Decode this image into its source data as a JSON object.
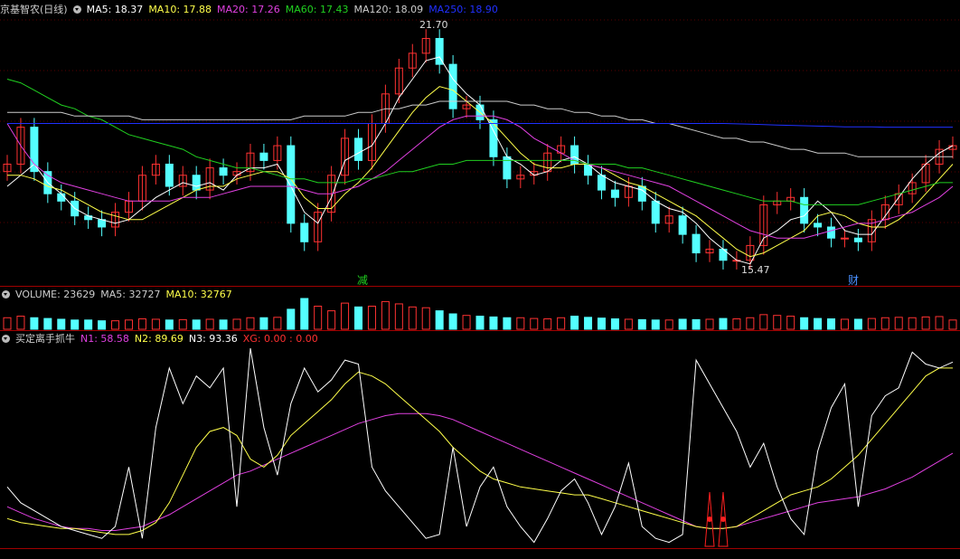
{
  "main": {
    "stock_name": "京基智农(日线)",
    "ma": [
      {
        "label": "MA5: 18.37",
        "color": "#ffffff"
      },
      {
        "label": "MA10: 17.88",
        "color": "#ffff4a"
      },
      {
        "label": "MA20: 17.26",
        "color": "#e040e0"
      },
      {
        "label": "MA60: 17.43",
        "color": "#20d020"
      },
      {
        "label": "MA120: 18.09",
        "color": "#cccccc"
      },
      {
        "label": "MA250: 18.90",
        "color": "#2030ff"
      }
    ],
    "high_label": "21.70",
    "low_label": "15.47",
    "marker_jian": "减",
    "marker_cai": "财"
  },
  "volume": {
    "label": "VOLUME: 23629",
    "ma5": "MA5: 32727",
    "ma10": "MA10: 32767",
    "colors": {
      "label": "#cccccc",
      "ma5": "#cccccc",
      "ma10": "#ffff4a"
    }
  },
  "indicator": {
    "name": "买定离手抓牛",
    "items": [
      {
        "label": "N1: 58.58",
        "color": "#e040e0"
      },
      {
        "label": "N2: 89.69",
        "color": "#ffff4a"
      },
      {
        "label": "N3: 93.36",
        "color": "#ffffff"
      },
      {
        "label": "XG: 0.00 : 0.00",
        "color": "#ff3030"
      }
    ]
  },
  "chart_data": [
    {
      "type": "line",
      "title": "京基智农(日线)",
      "series": [
        {
          "name": "MA5",
          "color": "#ffffff",
          "values": [
            17.3,
            17.6,
            17.9,
            17.4,
            17.1,
            16.7,
            16.5,
            16.4,
            16.3,
            16.4,
            16.7,
            17.0,
            17.2,
            17.4,
            17.3,
            17.4,
            17.2,
            17.6,
            17.8,
            17.8,
            17.9,
            17.3,
            16.6,
            16.3,
            17.0,
            18.0,
            18.2,
            18.4,
            19.0,
            19.7,
            20.2,
            20.7,
            20.8,
            20.2,
            19.8,
            19.5,
            18.8,
            18.1,
            17.9,
            17.6,
            17.7,
            18.0,
            18.1,
            17.9,
            17.6,
            17.4,
            17.3,
            17.2,
            16.9,
            16.7,
            16.6,
            16.3,
            15.9,
            15.6,
            15.3,
            15.2,
            15.9,
            16.1,
            16.4,
            16.5,
            16.9,
            16.6,
            16.1,
            16.0,
            16.0,
            16.5,
            17.0,
            17.5,
            17.9,
            18.2,
            18.4
          ]
        },
        {
          "name": "MA10",
          "color": "#ffff4a",
          "values": [
            17.6,
            17.6,
            17.5,
            17.3,
            17.2,
            17.0,
            16.8,
            16.6,
            16.5,
            16.4,
            16.4,
            16.6,
            16.8,
            17.0,
            17.2,
            17.3,
            17.3,
            17.5,
            17.6,
            17.7,
            17.7,
            17.5,
            17.0,
            16.7,
            16.7,
            17.1,
            17.4,
            17.8,
            18.3,
            18.8,
            19.3,
            19.7,
            20.0,
            19.9,
            19.6,
            19.3,
            19.0,
            18.6,
            18.2,
            17.9,
            17.8,
            17.8,
            17.9,
            17.9,
            17.8,
            17.6,
            17.4,
            17.3,
            17.1,
            16.9,
            16.7,
            16.5,
            16.2,
            15.9,
            15.6,
            15.4,
            15.5,
            15.7,
            15.9,
            16.1,
            16.5,
            16.6,
            16.5,
            16.3,
            16.2,
            16.2,
            16.4,
            16.7,
            17.1,
            17.5,
            17.9
          ]
        },
        {
          "name": "MA20",
          "color": "#e040e0",
          "values": [
            19.0,
            18.4,
            17.9,
            17.6,
            17.4,
            17.3,
            17.2,
            17.1,
            17.0,
            16.9,
            16.9,
            16.9,
            16.9,
            17.0,
            17.0,
            17.0,
            17.1,
            17.2,
            17.3,
            17.3,
            17.3,
            17.3,
            17.2,
            17.1,
            17.1,
            17.2,
            17.3,
            17.5,
            17.7,
            18.0,
            18.3,
            18.6,
            18.9,
            19.1,
            19.2,
            19.2,
            19.2,
            19.1,
            18.9,
            18.6,
            18.4,
            18.2,
            18.0,
            17.9,
            17.8,
            17.7,
            17.6,
            17.5,
            17.4,
            17.3,
            17.1,
            16.9,
            16.7,
            16.5,
            16.3,
            16.1,
            16.0,
            15.9,
            15.9,
            15.9,
            16.0,
            16.1,
            16.2,
            16.3,
            16.3,
            16.4,
            16.5,
            16.6,
            16.8,
            17.0,
            17.3
          ]
        },
        {
          "name": "MA60",
          "color": "#20d020",
          "values": [
            20.2,
            20.1,
            19.9,
            19.7,
            19.5,
            19.4,
            19.2,
            19.1,
            18.9,
            18.7,
            18.6,
            18.5,
            18.4,
            18.3,
            18.1,
            18.0,
            17.9,
            17.8,
            17.8,
            17.7,
            17.6,
            17.5,
            17.5,
            17.4,
            17.4,
            17.4,
            17.5,
            17.5,
            17.6,
            17.7,
            17.7,
            17.8,
            17.9,
            17.9,
            18.0,
            18.0,
            18.0,
            18.0,
            18.0,
            18.0,
            18.0,
            18.0,
            18.0,
            17.9,
            17.9,
            17.9,
            17.8,
            17.8,
            17.7,
            17.6,
            17.5,
            17.4,
            17.3,
            17.2,
            17.1,
            17.0,
            16.9,
            16.9,
            16.9,
            16.8,
            16.8,
            16.8,
            16.8,
            16.8,
            16.9,
            17.0,
            17.1,
            17.2,
            17.3,
            17.4,
            17.4
          ]
        },
        {
          "name": "MA120",
          "color": "#cccccc",
          "values": [
            19.3,
            19.3,
            19.3,
            19.3,
            19.3,
            19.2,
            19.2,
            19.2,
            19.2,
            19.2,
            19.1,
            19.1,
            19.1,
            19.1,
            19.1,
            19.1,
            19.1,
            19.1,
            19.1,
            19.1,
            19.1,
            19.1,
            19.2,
            19.2,
            19.2,
            19.2,
            19.3,
            19.3,
            19.4,
            19.4,
            19.5,
            19.5,
            19.6,
            19.6,
            19.6,
            19.6,
            19.6,
            19.6,
            19.5,
            19.5,
            19.4,
            19.4,
            19.3,
            19.3,
            19.2,
            19.2,
            19.1,
            19.1,
            19.0,
            19.0,
            18.9,
            18.8,
            18.7,
            18.6,
            18.6,
            18.5,
            18.5,
            18.4,
            18.3,
            18.3,
            18.2,
            18.2,
            18.2,
            18.1,
            18.1,
            18.1,
            18.1,
            18.1,
            18.1,
            18.1,
            18.1
          ]
        },
        {
          "name": "MA250",
          "color": "#2030ff",
          "values": [
            19.0,
            19.0,
            19.0,
            19.0,
            19.0,
            19.0,
            19.0,
            19.0,
            19.0,
            19.0,
            19.0,
            19.0,
            19.0,
            19.0,
            19.0,
            19.0,
            19.0,
            19.0,
            19.0,
            19.0,
            19.0,
            19.0,
            19.0,
            19.0,
            19.0,
            19.0,
            19.0,
            19.0,
            19.0,
            19.0,
            19.0,
            19.0,
            19.0,
            19.0,
            19.0,
            19.0,
            19.0,
            19.0,
            19.0,
            19.0,
            19.0,
            19.0,
            19.0,
            19.0,
            19.0,
            19.0,
            19.0,
            19.0,
            19.0,
            19.0,
            19.0,
            19.0,
            19.0,
            19.0,
            18.99,
            18.98,
            18.97,
            18.96,
            18.95,
            18.94,
            18.93,
            18.92,
            18.91,
            18.91,
            18.91,
            18.9,
            18.9,
            18.9,
            18.9,
            18.9,
            18.9
          ]
        }
      ],
      "candles_close": [
        17.9,
        18.9,
        17.7,
        17.1,
        16.9,
        16.5,
        16.4,
        16.2,
        16.6,
        16.9,
        17.6,
        17.9,
        17.3,
        17.6,
        17.2,
        17.8,
        17.6,
        17.7,
        18.2,
        18.0,
        18.4,
        16.3,
        15.8,
        16.6,
        17.6,
        18.6,
        18.0,
        19.0,
        19.8,
        20.5,
        20.9,
        21.3,
        20.6,
        19.4,
        19.5,
        19.1,
        18.1,
        17.5,
        17.6,
        17.7,
        18.2,
        18.4,
        17.9,
        17.6,
        17.2,
        17.0,
        17.3,
        16.9,
        16.3,
        16.5,
        16.0,
        15.5,
        15.6,
        15.3,
        15.3,
        15.7,
        16.8,
        16.9,
        17.0,
        16.3,
        16.2,
        15.9,
        15.9,
        15.8,
        16.4,
        16.8,
        17.1,
        17.4,
        17.9,
        18.3,
        18.4
      ],
      "ylim": [
        15.0,
        21.9
      ]
    },
    {
      "type": "bar",
      "title": "VOLUME",
      "values": [
        30,
        34,
        30,
        28,
        26,
        24,
        24,
        22,
        22,
        24,
        27,
        26,
        24,
        25,
        24,
        26,
        24,
        26,
        30,
        30,
        31,
        52,
        80,
        60,
        48,
        68,
        58,
        60,
        72,
        66,
        58,
        56,
        48,
        40,
        36,
        34,
        32,
        30,
        30,
        28,
        27,
        30,
        34,
        31,
        29,
        27,
        26,
        25,
        24,
        24,
        26,
        25,
        26,
        28,
        27,
        30,
        38,
        36,
        34,
        30,
        28,
        27,
        26,
        26,
        28,
        30,
        31,
        30,
        32,
        33,
        24
      ]
    },
    {
      "type": "line",
      "title": "买定离手抓牛",
      "series": [
        {
          "name": "N1",
          "color": "#e040e0",
          "values": [
            20,
            17,
            14,
            12,
            10,
            9,
            9,
            8,
            8,
            9,
            10,
            13,
            16,
            20,
            24,
            28,
            32,
            36,
            38,
            41,
            44,
            47,
            50,
            53,
            56,
            59,
            62,
            64,
            66,
            67,
            67,
            67,
            66,
            64,
            61,
            58,
            55,
            52,
            49,
            46,
            43,
            40,
            37,
            34,
            31,
            28,
            25,
            22,
            19,
            16,
            13,
            10,
            9,
            9,
            10,
            12,
            14,
            16,
            18,
            20,
            22,
            23,
            24,
            25,
            27,
            29,
            32,
            35,
            39,
            43,
            47
          ]
        },
        {
          "name": "N2",
          "color": "#ffff4a",
          "values": [
            14,
            12,
            11,
            10,
            9,
            9,
            8,
            7,
            6,
            6,
            8,
            12,
            22,
            36,
            50,
            58,
            60,
            56,
            44,
            40,
            46,
            56,
            62,
            68,
            74,
            82,
            88,
            86,
            82,
            76,
            70,
            64,
            58,
            50,
            44,
            38,
            34,
            32,
            30,
            29,
            28,
            27,
            26,
            26,
            24,
            22,
            20,
            18,
            16,
            14,
            12,
            10,
            9,
            9,
            10,
            14,
            18,
            22,
            26,
            28,
            30,
            34,
            40,
            46,
            54,
            62,
            70,
            78,
            86,
            90,
            90
          ]
        },
        {
          "name": "N3",
          "color": "#ffffff",
          "values": [
            30,
            22,
            18,
            14,
            10,
            8,
            6,
            4,
            10,
            40,
            4,
            60,
            90,
            72,
            86,
            80,
            90,
            20,
            100,
            60,
            36,
            72,
            90,
            78,
            84,
            94,
            92,
            40,
            28,
            20,
            12,
            4,
            6,
            50,
            10,
            30,
            40,
            20,
            10,
            2,
            14,
            28,
            34,
            22,
            6,
            20,
            42,
            10,
            4,
            2,
            6,
            94,
            82,
            70,
            58,
            40,
            52,
            30,
            14,
            6,
            48,
            70,
            82,
            20,
            66,
            76,
            80,
            98,
            92,
            90,
            93
          ]
        }
      ],
      "ylim": [
        0,
        100
      ]
    }
  ]
}
